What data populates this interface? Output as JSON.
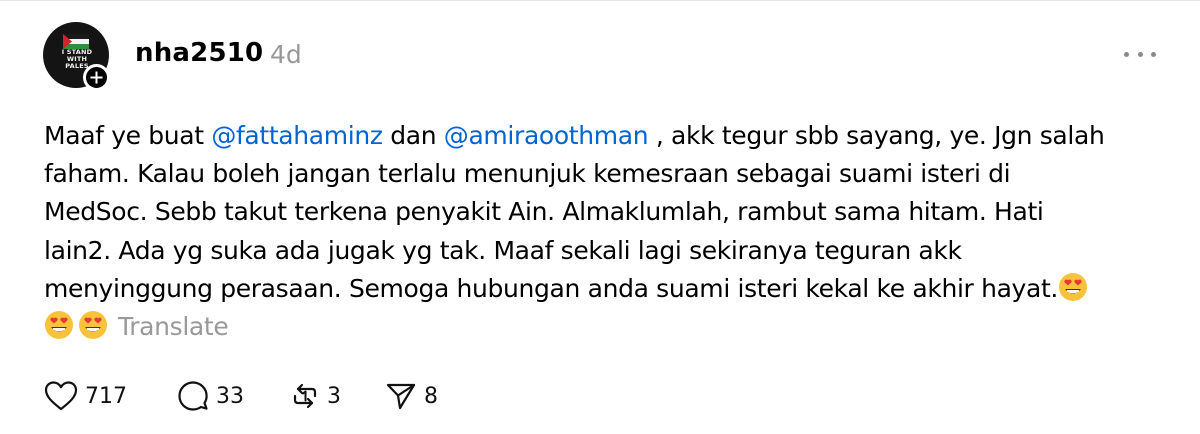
{
  "post": {
    "author": {
      "username": "nha2510",
      "avatar_text": "I STAND WITH PALES"
    },
    "time": "4d",
    "text_lines": [
      {
        "parts": [
          {
            "type": "text",
            "value": "Maaf ye buat "
          },
          {
            "type": "mention",
            "value": "@fattahaminz"
          },
          {
            "type": "text",
            "value": " dan "
          },
          {
            "type": "mention",
            "value": "@amiraoothman"
          },
          {
            "type": "text",
            "value": " , akk tegur sbb sayang, ye. Jgn salah"
          }
        ]
      },
      {
        "parts": [
          {
            "type": "text",
            "value": "faham. Kalau boleh jangan terlalu menunjuk kemesraan sebagai suami isteri di"
          }
        ]
      },
      {
        "parts": [
          {
            "type": "text",
            "value": "MedSoc. Sebb takut terkena penyakit Ain. Almaklumlah, rambut sama hitam. Hati"
          }
        ]
      },
      {
        "parts": [
          {
            "type": "text",
            "value": "lain2. Ada yg suka ada jugak yg tak. Maaf sekali lagi sekiranya teguran akk"
          }
        ]
      },
      {
        "parts": [
          {
            "type": "text",
            "value": "menyinggung perasaan. Semoga hubungan anda suami isteri kekal ke akhir hayat."
          },
          {
            "type": "emoji",
            "value": "heart-eyes"
          }
        ]
      },
      {
        "parts": [
          {
            "type": "emoji",
            "value": "heart-eyes"
          },
          {
            "type": "emoji",
            "value": "heart-eyes"
          },
          {
            "type": "translate",
            "value": "Translate"
          }
        ]
      }
    ],
    "actions": {
      "likes": "717",
      "replies": "33",
      "reposts": "3",
      "shares": "8"
    }
  },
  "colors": {
    "mention": "#0064d1",
    "muted": "#999999",
    "text": "#000000"
  },
  "icons": [
    "follow-plus-icon",
    "more-options-icon",
    "heart-icon",
    "reply-bubble-icon",
    "repost-icon",
    "share-icon",
    "heart-eyes-emoji"
  ]
}
